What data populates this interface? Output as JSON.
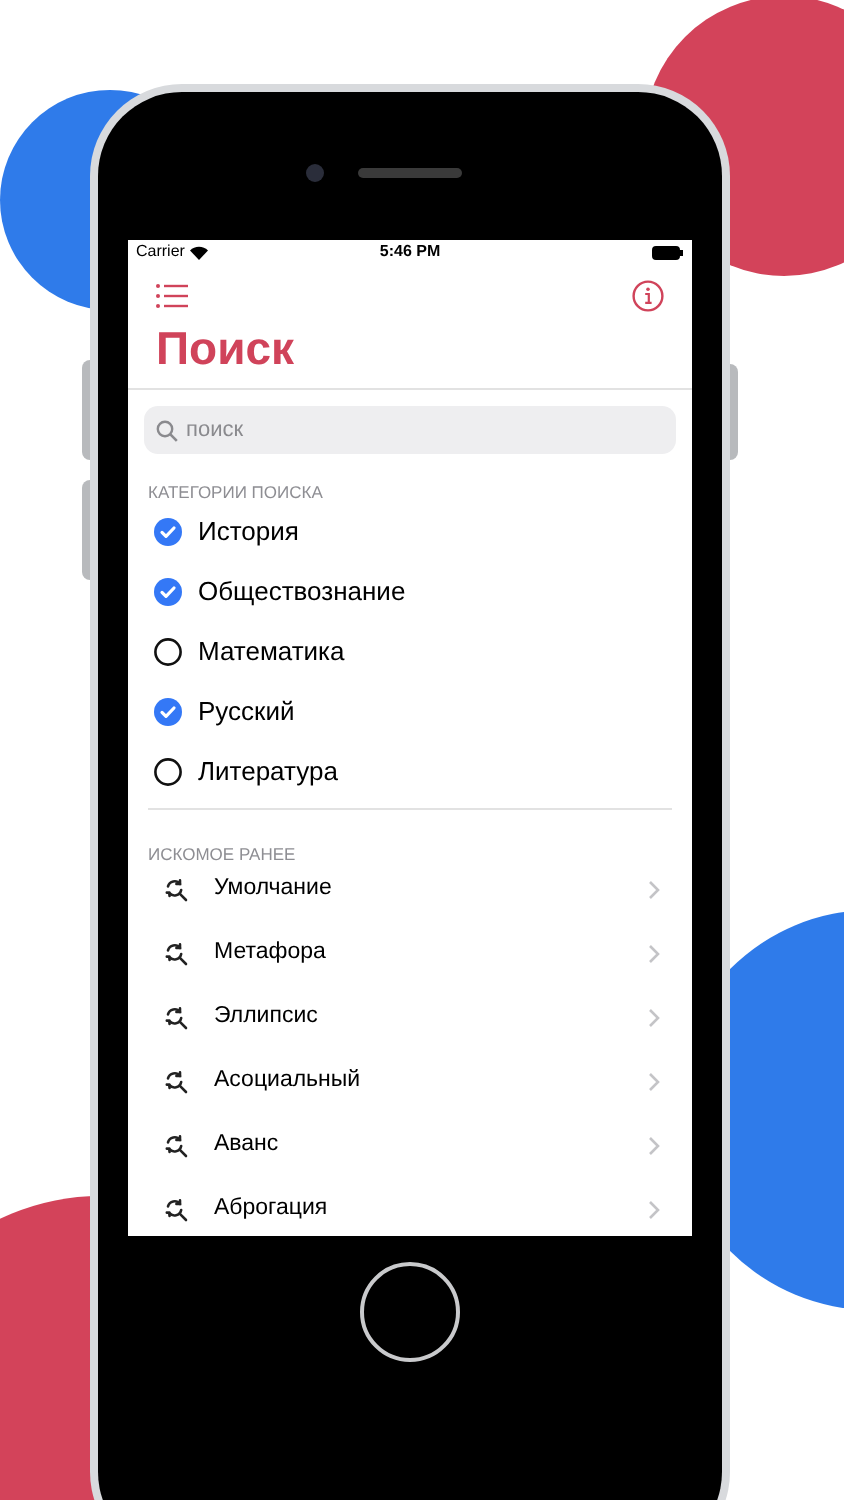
{
  "status_bar": {
    "carrier": "Carrier",
    "time": "5:46 PM"
  },
  "title": "Поиск",
  "search": {
    "placeholder": "поиск"
  },
  "categories": {
    "header": "КАТЕГОРИИ ПОИСКА",
    "items": [
      {
        "label": "История",
        "checked": true
      },
      {
        "label": "Обществознание",
        "checked": true
      },
      {
        "label": "Математика",
        "checked": false
      },
      {
        "label": "Русский",
        "checked": true
      },
      {
        "label": "Литература",
        "checked": false
      }
    ]
  },
  "recent": {
    "header": "ИСКОМОЕ РАНЕЕ",
    "items": [
      {
        "label": "Умолчание"
      },
      {
        "label": "Метафора"
      },
      {
        "label": "Эллипсис"
      },
      {
        "label": "Асоциальный"
      },
      {
        "label": "Аванс"
      },
      {
        "label": "Аброгация"
      }
    ]
  }
}
